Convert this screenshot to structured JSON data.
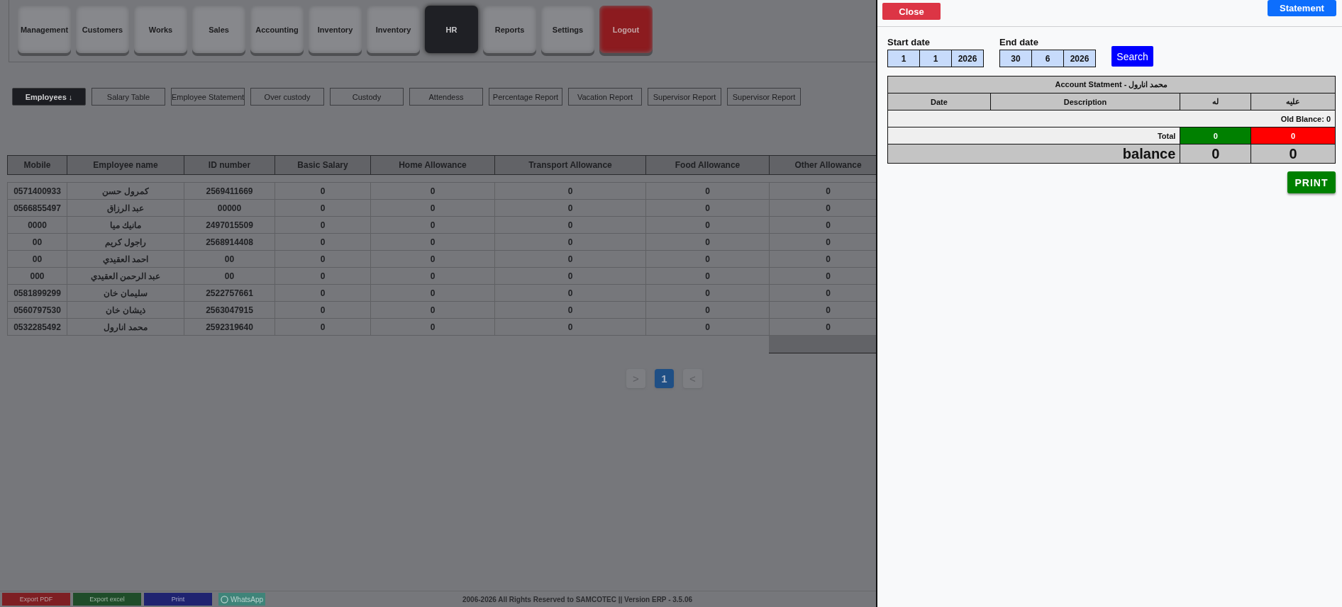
{
  "nav": [
    {
      "label": "Management",
      "kind": "normal",
      "selected": false
    },
    {
      "label": "Customers",
      "kind": "normal",
      "selected": false
    },
    {
      "label": "Works",
      "kind": "normal",
      "selected": false
    },
    {
      "label": "Sales",
      "kind": "normal",
      "selected": false
    },
    {
      "label": "Accounting",
      "kind": "normal",
      "selected": false
    },
    {
      "label": "Inventory",
      "kind": "normal",
      "selected": false
    },
    {
      "label": "Inventory",
      "kind": "normal",
      "selected": false
    },
    {
      "label": "HR",
      "kind": "normal",
      "selected": true
    },
    {
      "label": "Reports",
      "kind": "normal",
      "selected": false
    },
    {
      "label": "Settings",
      "kind": "normal",
      "selected": false
    },
    {
      "label": "Logout",
      "kind": "logout",
      "selected": false
    }
  ],
  "subtabs": [
    {
      "label": "Employees",
      "selected": true,
      "icon": "↓"
    },
    {
      "label": "Salary Table",
      "selected": false
    },
    {
      "label": "Employee Statement",
      "selected": false
    },
    {
      "label": "Over custody",
      "selected": false
    },
    {
      "label": "Custody",
      "selected": false
    },
    {
      "label": "Attendess",
      "selected": false
    },
    {
      "label": "Percentage Report",
      "selected": false
    },
    {
      "label": "Vacation Report",
      "selected": false
    },
    {
      "label": "Supervisor Report",
      "selected": false
    },
    {
      "label": "Supervisor Report",
      "selected": false
    }
  ],
  "table": {
    "columns": [
      "Mobile",
      "Employee name",
      "ID number",
      "Basic Salary",
      "Home Allowance",
      "Transport Allowance",
      "Food Allowance",
      "Other Allowance"
    ],
    "rows": [
      [
        "0571400933",
        "كمرول حسن",
        "2569411669",
        "0",
        "0",
        "0",
        "0",
        "0"
      ],
      [
        "0566855497",
        "عبد الرزاق",
        "00000",
        "0",
        "0",
        "0",
        "0",
        "0"
      ],
      [
        "0000",
        "مانيك ميا",
        "2497015509",
        "0",
        "0",
        "0",
        "0",
        "0"
      ],
      [
        "00",
        "راجول كريم",
        "2568914408",
        "0",
        "0",
        "0",
        "0",
        "0"
      ],
      [
        "00",
        "احمد العقيدي",
        "00",
        "0",
        "0",
        "0",
        "0",
        "0"
      ],
      [
        "000",
        "عبد الرحمن العقيدي",
        "00",
        "0",
        "0",
        "0",
        "0",
        "0"
      ],
      [
        "0581899299",
        "سليمان خان",
        "2522757661",
        "0",
        "0",
        "0",
        "0",
        "0"
      ],
      [
        "0560797530",
        "ذيشان خان",
        "2563047915",
        "0",
        "0",
        "0",
        "0",
        "0"
      ],
      [
        "0532285492",
        "محمد انارول",
        "2592319640",
        "0",
        "0",
        "0",
        "0",
        "0"
      ]
    ]
  },
  "pagination": [
    {
      "label": ">",
      "selected": false
    },
    {
      "label": "1",
      "selected": true
    },
    {
      "label": "<",
      "selected": false
    }
  ],
  "footer": {
    "buttons": [
      {
        "label": "Export PDF",
        "kind": "pdf"
      },
      {
        "label": "Export excel",
        "kind": "excel"
      },
      {
        "label": "Print",
        "kind": "print"
      },
      {
        "label": "WhatsApp",
        "kind": "whatsapp"
      }
    ],
    "copyright": "2006-2026 All Rights Reserved to  SAMCOTEC || Version ERP - 3.5.06"
  },
  "panel": {
    "close": "Close",
    "statement": "Statement",
    "start_date": {
      "label": "Start date",
      "parts": [
        "1",
        "1",
        "2026"
      ]
    },
    "end_date": {
      "label": "End date",
      "parts": [
        "30",
        "6",
        "2026"
      ]
    },
    "search": "Search",
    "statement_table": {
      "title": "Account Statment - محمد انارول",
      "columns": [
        "Date",
        "Description",
        "له",
        "عليه"
      ],
      "old_balance": "Old Blance: 0",
      "total_label": "Total",
      "total_credit": "0",
      "total_debit": "0",
      "balance_label": "balance",
      "balance_credit": "0",
      "balance_debit": "0"
    },
    "print": "PRINT"
  }
}
